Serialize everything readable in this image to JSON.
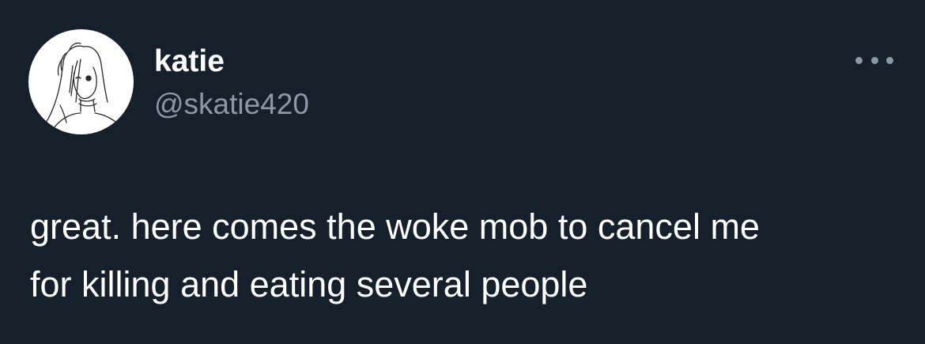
{
  "author": {
    "display_name": "katie",
    "handle": "@skatie420",
    "avatar_icon": "sketch-portrait-icon"
  },
  "menu": {
    "icon": "more-options-icon"
  },
  "tweet": {
    "text": "great. here comes the woke mob to cancel me\nfor killing and eating several people"
  },
  "colors": {
    "background": "#15202b",
    "primary_text": "#ffffff",
    "secondary_text": "#8b98a5"
  }
}
